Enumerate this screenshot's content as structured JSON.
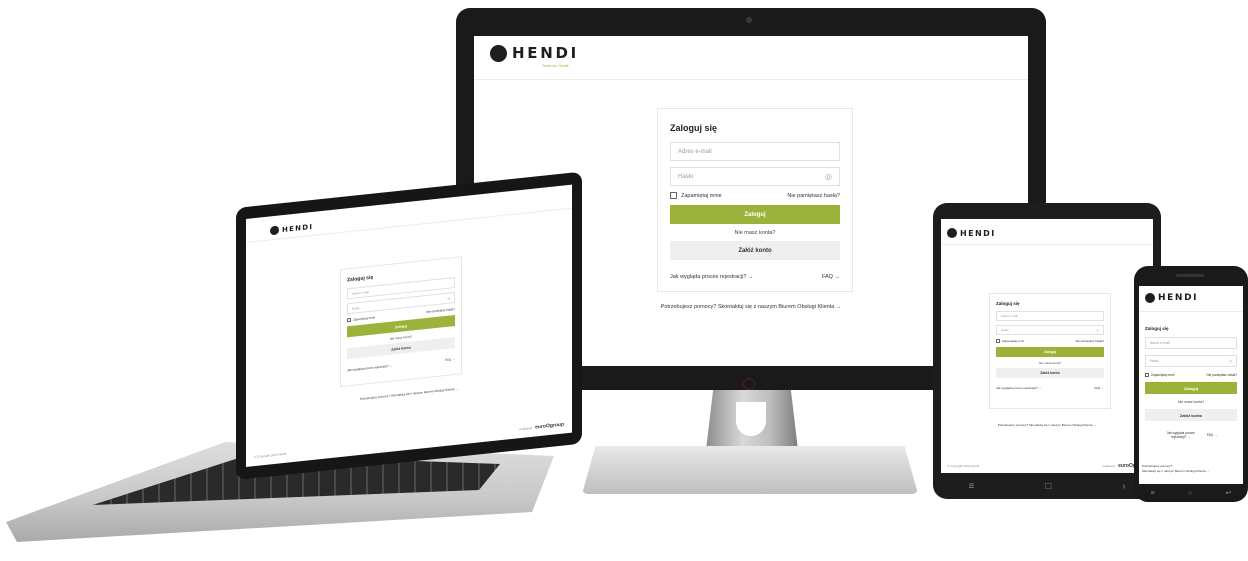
{
  "brand": {
    "name": "HENDI",
    "tagline": "Tools for Chefs",
    "accent_color": "#9cb33b"
  },
  "login": {
    "title": "Zaloguj się",
    "email_placeholder": "Adres e-mail",
    "password_placeholder": "Hasło",
    "remember_me": "Zapamiętaj mnie",
    "forgot_password": "Nie pamiętasz hasła?",
    "login_button": "Zaloguj",
    "no_account": "Nie masz konta?",
    "create_account_button": "Załóż konto",
    "registration_process_link": "Jak wygląda proces rejestracji?",
    "faq_link": "FAQ",
    "arrow": "→",
    "help_text": "Potrzebujesz pomocy? Skontaktuj się z naszym Biurem Obsługi Klienta",
    "help_text_line1": "Potrzebujesz pomocy?",
    "help_text_line2": "Skontaktuj się z naszym Biurem Obsługi Klienta"
  },
  "footer": {
    "copyright": "© Copyright 2022 Hendi",
    "realized_by": "realizacja",
    "agency": "euroOgroup"
  },
  "icons": {
    "password_toggle": "eye-icon",
    "logo": "hendi-logo-icon"
  }
}
